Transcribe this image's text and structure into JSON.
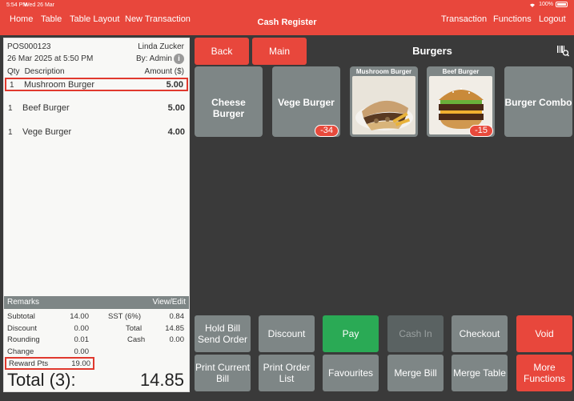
{
  "status_bar": {
    "time": "5:54 PM",
    "date": "Wed 26 Mar",
    "battery": "100%"
  },
  "header": {
    "left_nav": [
      "Home",
      "Table",
      "Table Layout",
      "New Transaction"
    ],
    "title": "Cash Register",
    "right_nav": [
      "Transaction",
      "Functions",
      "Logout"
    ]
  },
  "receipt": {
    "bill_no": "POS000123",
    "customer": "Linda Zucker",
    "datetime": "26 Mar 2025 at 5:50 PM",
    "by": "By: Admin",
    "col_qty": "Qty",
    "col_desc": "Description",
    "col_amount": "Amount ($)",
    "items": [
      {
        "qty": "1",
        "desc": "Mushroom Burger",
        "amount": "5.00",
        "selected": true
      },
      {
        "qty": "1",
        "desc": "Beef Burger",
        "amount": "5.00"
      },
      {
        "qty": "1",
        "desc": "Vege Burger",
        "amount": "4.00"
      }
    ],
    "remarks": "Remarks",
    "view_edit": "View/Edit",
    "subtotal_label": "Subtotal",
    "subtotal": "14.00",
    "sst_label": "SST (6%)",
    "sst": "0.84",
    "discount_label": "Discount",
    "discount": "0.00",
    "total_label": "Total",
    "total": "14.85",
    "rounding_label": "Rounding",
    "rounding": "0.01",
    "cash_label": "Cash",
    "cash": "0.00",
    "change_label": "Change",
    "change": "0.00",
    "reward_label": "Reward Pts",
    "reward": "19.00",
    "grand_label": "Total (3):",
    "grand_total": "14.85"
  },
  "top_buttons": {
    "back": "Back",
    "main": "Main"
  },
  "category_title": "Burgers",
  "products": [
    {
      "name": "Cheese Burger"
    },
    {
      "name": "Vege Burger",
      "badge": "-34"
    },
    {
      "name": "Mushroom Burger"
    },
    {
      "name": "Beef Burger",
      "badge": "-15"
    },
    {
      "name": "Burger Combo"
    }
  ],
  "actions_row1": [
    "Hold Bill Send Order",
    "Discount",
    "Pay",
    "Cash In",
    "Checkout",
    "Void"
  ],
  "actions_row2": [
    "Print Current Bill",
    "Print Order List",
    "Favourites",
    "Merge Bill",
    "Merge Table",
    "More Functions"
  ],
  "colors": {
    "accent": "#e8473c",
    "pay": "#2aaa55",
    "tile": "#7e8686",
    "background": "#3a3a3a"
  }
}
